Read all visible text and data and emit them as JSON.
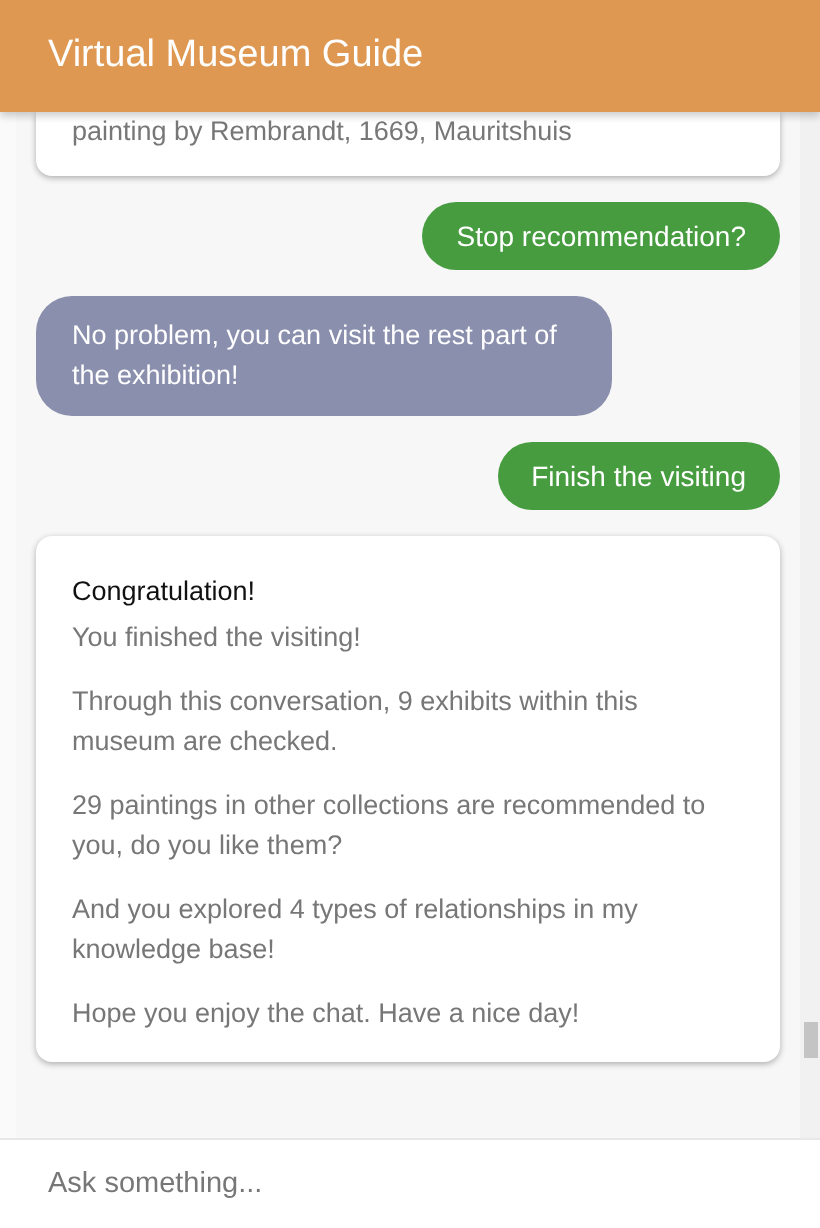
{
  "header": {
    "title": "Virtual Museum Guide"
  },
  "messages": [
    {
      "kind": "card_tail",
      "text": "painting by Rembrandt, 1669, Mauritshuis"
    },
    {
      "kind": "user",
      "text": "Stop recommendation?"
    },
    {
      "kind": "bot",
      "text": "No problem, you can visit the rest part of the exhibition!"
    },
    {
      "kind": "user",
      "text": "Finish the visiting"
    },
    {
      "kind": "card",
      "title": "Congratulation!",
      "paragraphs": [
        "You finished the visiting!",
        "Through this conversation, 9 exhibits within this museum are checked.",
        "29 paintings in other collections are recommended to you, do you like them?",
        "And you explored 4 types of relationships in my knowledge base!",
        "Hope you enjoy the chat. Have a nice day!"
      ]
    }
  ],
  "input": {
    "placeholder": "Ask something..."
  }
}
